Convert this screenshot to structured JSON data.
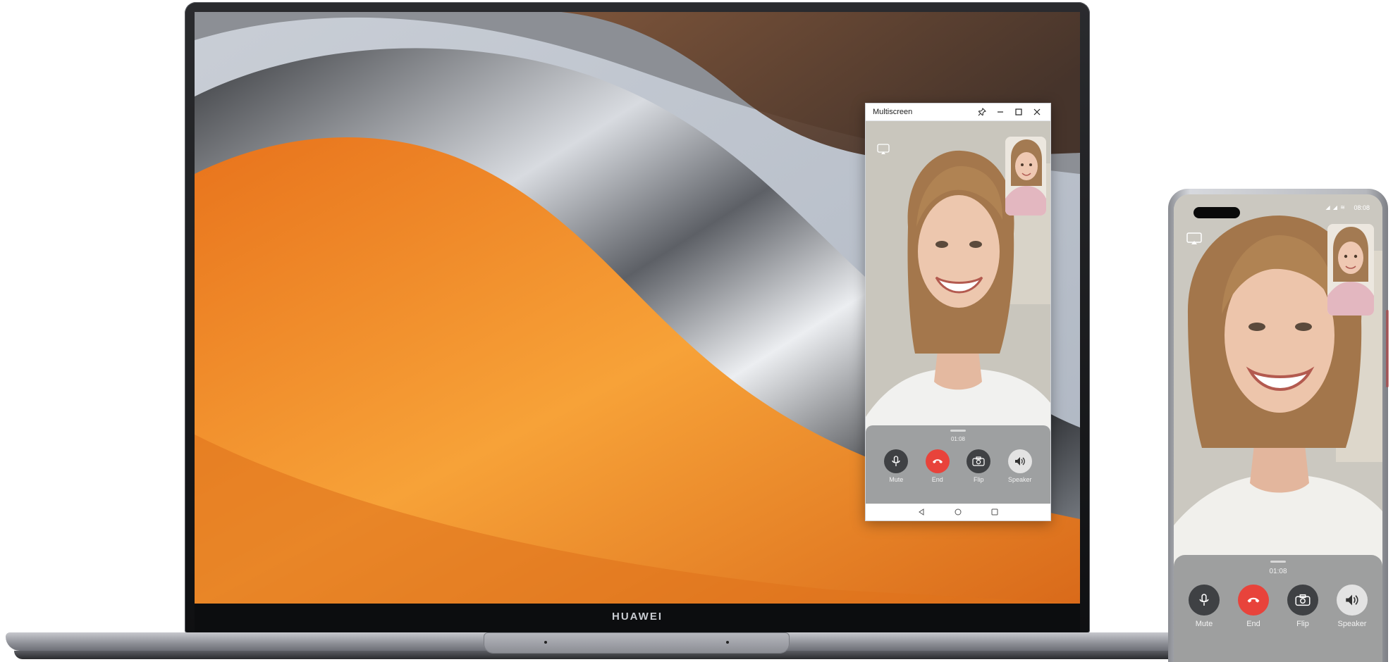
{
  "laptop": {
    "brand": "HUAWEI"
  },
  "multiscreen": {
    "title": "Multiscreen",
    "controls": {
      "pin_icon": "pin-icon",
      "minimize_icon": "minimize-icon",
      "maximize_icon": "maximize-icon",
      "close_icon": "close-icon"
    },
    "call": {
      "timer": "01:08",
      "buttons": [
        {
          "label": "Mute",
          "icon": "microphone-icon"
        },
        {
          "label": "End",
          "icon": "end-call-icon"
        },
        {
          "label": "Flip",
          "icon": "flip-camera-icon"
        },
        {
          "label": "Speaker",
          "icon": "speaker-icon"
        }
      ]
    },
    "navbar": [
      "back-icon",
      "home-icon",
      "recents-icon"
    ]
  },
  "phone": {
    "status": {
      "time": "08:08",
      "icons": "◢ ◢ ≋"
    },
    "call": {
      "timer": "01:08",
      "buttons": [
        {
          "label": "Mute",
          "icon": "microphone-icon"
        },
        {
          "label": "End",
          "icon": "end-call-icon"
        },
        {
          "label": "Flip",
          "icon": "flip-camera-icon"
        },
        {
          "label": "Speaker",
          "icon": "speaker-icon"
        }
      ]
    }
  },
  "colors": {
    "end_button": "#e8433b",
    "control_button": "#3f4144",
    "speaker_active": "#e3e3e3",
    "wallpaper_orange": "#f08a1e"
  }
}
